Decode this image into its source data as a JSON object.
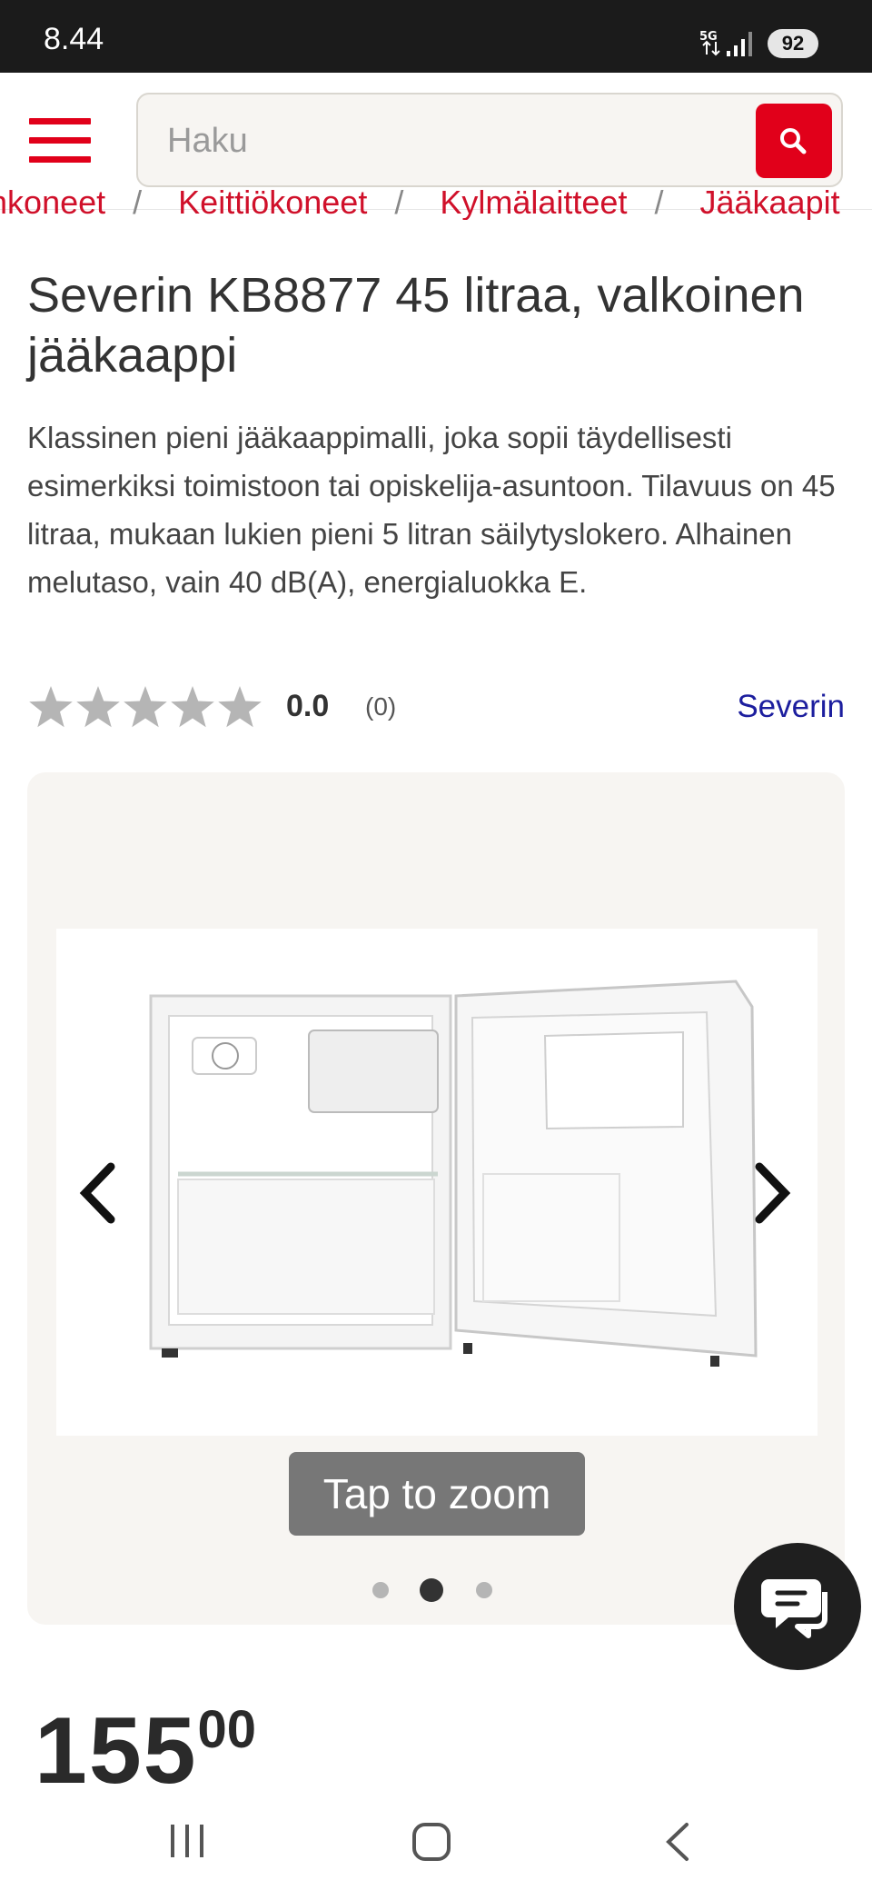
{
  "status_bar": {
    "time": "8.44",
    "network": "5G",
    "battery": "92"
  },
  "search": {
    "placeholder": "Haku"
  },
  "breadcrumb": [
    {
      "label": "uinkoneet"
    },
    {
      "label": "Keittiökoneet"
    },
    {
      "label": "Kylmälaitteet"
    },
    {
      "label": "Jääkaapit"
    }
  ],
  "product": {
    "title": "Severin KB8877 45 litraa, valkoinen jääkaappi",
    "description": "Klassinen pieni jääkaappimalli, joka sopii täydellisesti esimerkiksi toimistoon tai opiskelija-asuntoon. Tilavuus on 45 litraa, mukaan lukien pieni 5 litran säilytyslokero. Alhainen melutaso, vain 40 dB(A), energialuokka E.",
    "rating_value": "0.0",
    "rating_count": "(0)",
    "rating_stars_filled": 0,
    "brand": "Severin"
  },
  "gallery": {
    "zoom_label": "Tap to zoom",
    "image_count": 3,
    "active_index": 1
  },
  "price": {
    "main": "155",
    "cents": "00"
  },
  "colors": {
    "accent": "#e1001a",
    "brand_link": "#1c1e9e",
    "star_empty": "#b5b5b5"
  },
  "icons": {
    "menu": "hamburger-icon",
    "search": "search-icon",
    "prev": "chevron-left-icon",
    "next": "chevron-right-icon",
    "chat": "chat-icon",
    "star": "star-icon"
  }
}
